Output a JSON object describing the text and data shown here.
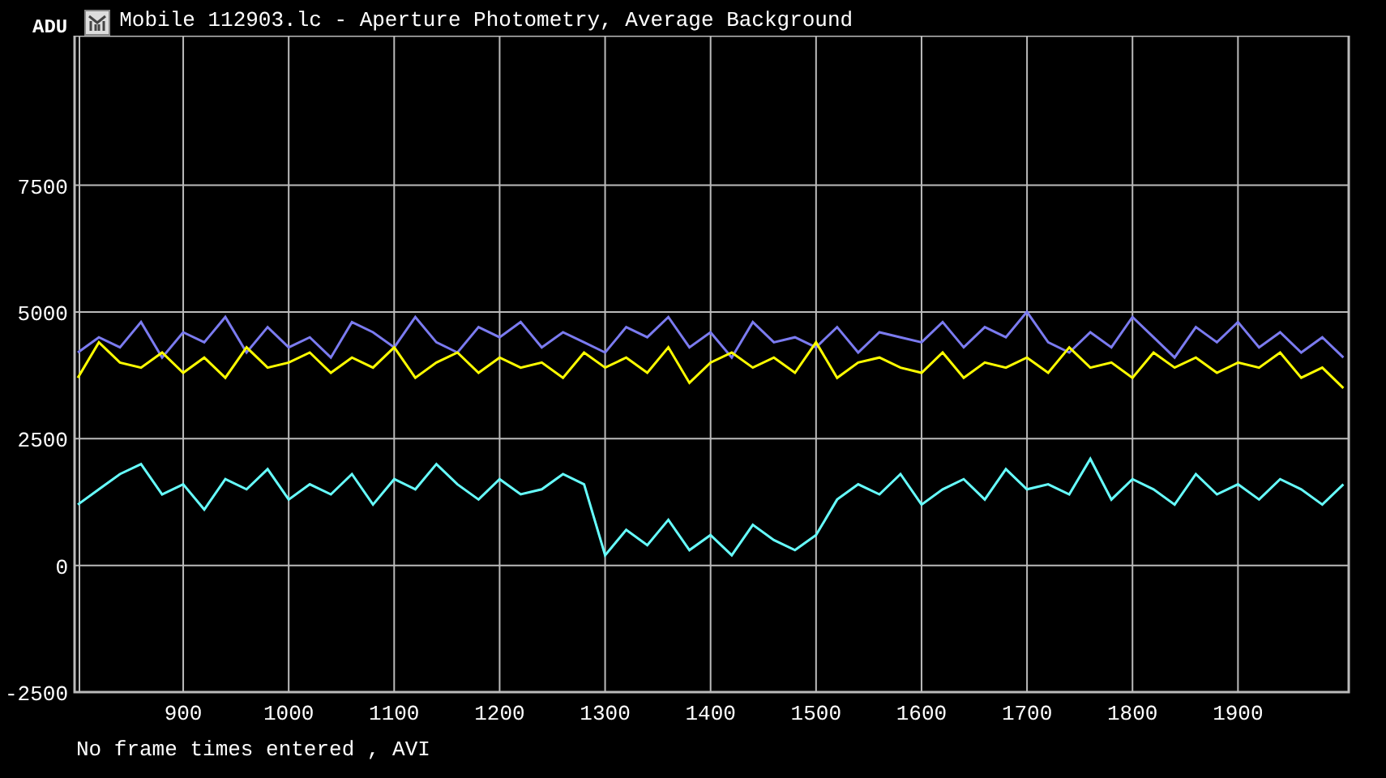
{
  "window": {
    "title": "Mobile 112903.lc - Aperture Photometry, Average Background"
  },
  "chart": {
    "chart_data": {
      "type": "line",
      "grid": true,
      "ylabel": "ADU",
      "xlim": [
        797,
        2005
      ],
      "ylim": [
        -2500,
        10450
      ],
      "xticks": [
        900,
        1000,
        1100,
        1200,
        1300,
        1400,
        1500,
        1600,
        1700,
        1800,
        1900
      ],
      "yticks": [
        -2500,
        0,
        2500,
        5000,
        7500
      ],
      "x": [
        800,
        820,
        840,
        860,
        880,
        900,
        920,
        940,
        960,
        980,
        1000,
        1020,
        1040,
        1060,
        1080,
        1100,
        1120,
        1140,
        1160,
        1180,
        1200,
        1220,
        1240,
        1260,
        1280,
        1300,
        1320,
        1340,
        1360,
        1380,
        1400,
        1420,
        1440,
        1460,
        1480,
        1500,
        1520,
        1540,
        1560,
        1580,
        1600,
        1620,
        1640,
        1660,
        1680,
        1700,
        1720,
        1740,
        1760,
        1780,
        1800,
        1820,
        1840,
        1860,
        1880,
        1900,
        1920,
        1940,
        1960,
        1980,
        2000
      ],
      "series": [
        {
          "color": "#7b7bf0",
          "values": [
            4200,
            4500,
            4300,
            4800,
            4100,
            4600,
            4400,
            4900,
            4200,
            4700,
            4300,
            4500,
            4100,
            4800,
            4600,
            4300,
            4900,
            4400,
            4200,
            4700,
            4500,
            4800,
            4300,
            4600,
            4400,
            4200,
            4700,
            4500,
            4900,
            4300,
            4600,
            4100,
            4800,
            4400,
            4500,
            4300,
            4700,
            4200,
            4600,
            4500,
            4400,
            4800,
            4300,
            4700,
            4500,
            5000,
            4400,
            4200,
            4600,
            4300,
            4900,
            4500,
            4100,
            4700,
            4400,
            4800,
            4300,
            4600,
            4200,
            4500,
            4100
          ]
        },
        {
          "color": "#ffff00",
          "values": [
            3700,
            4400,
            4000,
            3900,
            4200,
            3800,
            4100,
            3700,
            4300,
            3900,
            4000,
            4200,
            3800,
            4100,
            3900,
            4300,
            3700,
            4000,
            4200,
            3800,
            4100,
            3900,
            4000,
            3700,
            4200,
            3900,
            4100,
            3800,
            4300,
            3600,
            4000,
            4200,
            3900,
            4100,
            3800,
            4400,
            3700,
            4000,
            4100,
            3900,
            3800,
            4200,
            3700,
            4000,
            3900,
            4100,
            3800,
            4300,
            3900,
            4000,
            3700,
            4200,
            3900,
            4100,
            3800,
            4000,
            3900,
            4200,
            3700,
            3900,
            3500
          ]
        },
        {
          "color": "#66ffff",
          "values": [
            1200,
            1500,
            1800,
            2000,
            1400,
            1600,
            1100,
            1700,
            1500,
            1900,
            1300,
            1600,
            1400,
            1800,
            1200,
            1700,
            1500,
            2000,
            1600,
            1300,
            1700,
            1400,
            1500,
            1800,
            1600,
            200,
            700,
            400,
            900,
            300,
            600,
            200,
            800,
            500,
            300,
            600,
            1300,
            1600,
            1400,
            1800,
            1200,
            1500,
            1700,
            1300,
            1900,
            1500,
            1600,
            1400,
            2100,
            1300,
            1700,
            1500,
            1200,
            1800,
            1400,
            1600,
            1300,
            1700,
            1500,
            1200,
            1600
          ]
        }
      ]
    }
  },
  "status_bar": {
    "text": "No frame times entered , AVI"
  }
}
